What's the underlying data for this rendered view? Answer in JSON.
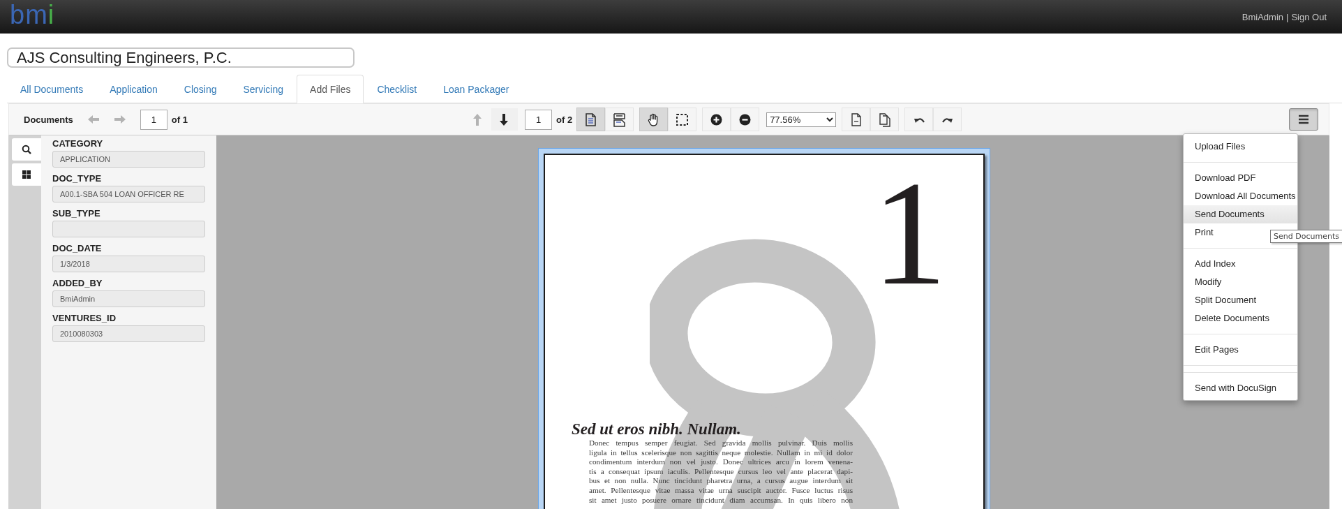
{
  "header": {
    "logo": "bmi",
    "user_link": "BmiAdmin",
    "separator": "|",
    "sign_out_link": "Sign Out"
  },
  "borrower_field": {
    "value": "AJS Consulting Engineers, P.C."
  },
  "tabs": [
    {
      "label": "All Documents",
      "selected": false
    },
    {
      "label": "Application",
      "selected": false
    },
    {
      "label": "Closing",
      "selected": false
    },
    {
      "label": "Servicing",
      "selected": false
    },
    {
      "label": "Add Files",
      "selected": true
    },
    {
      "label": "Checklist",
      "selected": false
    },
    {
      "label": "Loan Packager",
      "selected": false
    }
  ],
  "toolbar": {
    "documents_label": "Documents",
    "document_nav": [
      {
        "kind": "left",
        "disabled": true
      },
      {
        "kind": "right",
        "disabled": true
      }
    ],
    "document_number": "1",
    "document_total": "of 1",
    "page_nav": [
      {
        "kind": "up",
        "disabled": true
      },
      {
        "kind": "down",
        "disabled": false
      }
    ],
    "page_number": "1",
    "page_total": "of 2",
    "groups": [
      {
        "kind": "buttons",
        "buttons": [
          {
            "kind": "single-page",
            "selected": true
          },
          {
            "kind": "two-page",
            "selected": false
          }
        ]
      },
      {
        "kind": "buttons",
        "buttons": [
          {
            "kind": "hand",
            "selected": true
          },
          {
            "kind": "marquee",
            "selected": false
          }
        ]
      },
      {
        "kind": "buttons",
        "buttons": [
          {
            "kind": "zoom-in",
            "selected": false
          },
          {
            "kind": "zoom-out",
            "selected": false
          }
        ]
      },
      {
        "kind": "select",
        "value": "77.56%"
      },
      {
        "kind": "buttons",
        "buttons": [
          {
            "kind": "page",
            "selected": false
          },
          {
            "kind": "pages",
            "selected": false
          }
        ]
      },
      {
        "kind": "buttons",
        "buttons": [
          {
            "kind": "undo",
            "selected": false
          },
          {
            "kind": "redo",
            "selected": false
          }
        ]
      }
    ],
    "menu_button": {
      "expanded": true
    }
  },
  "side_buttons": [
    {
      "kind": "search"
    },
    {
      "kind": "grid"
    }
  ],
  "fields": [
    {
      "label": "CATEGORY",
      "value": "APPLICATION",
      "disabled": true
    },
    {
      "label": "DOC_TYPE",
      "value": "A00.1-SBA 504 LOAN OFFICER RE",
      "disabled": true
    },
    {
      "label": "SUB_TYPE",
      "disabled": true
    },
    {
      "label": "DOC_DATE",
      "value": "1/3/2018",
      "disabled": true
    },
    {
      "label": "ADDED_BY",
      "value": "BmiAdmin",
      "disabled": true
    },
    {
      "label": "VENTURES_ID",
      "value": "2010080303",
      "disabled": true
    }
  ],
  "document": {
    "page_number": "1",
    "heading": "Sed ut eros nibh. Nullam.",
    "body_lines": [
      "Donec tempus semper feugiat. Sed gravida mollis pulvinar. Duis mollis",
      "ligula in tellus scelerisque non sagittis neque molestie. Nullam in mi id dolor",
      "condimentum interdum non vel justo. Donec ultrices arcu in lorem venena-",
      "tis a consequat ipsum iaculis. Pellentesque cursus leo vel ante placerat dapi-",
      "bus et non nulla. Nunc tincidunt pharetra urna, a cursus augue interdum sit",
      "amet. Pellentesque vitae massa vitae urna suscipit auctor. Fusce luctus risus",
      "sit amet justo posuere ornare tincidunt diam accumsan. In quis libero non"
    ]
  },
  "menu": {
    "items": [
      {
        "kind": "item",
        "label": "Upload Files",
        "highlighted": false
      },
      {
        "kind": "divider"
      },
      {
        "kind": "item",
        "label": "Download PDF",
        "highlighted": false
      },
      {
        "kind": "item",
        "label": "Download All Documents",
        "highlighted": false
      },
      {
        "kind": "item",
        "label": "Send Documents",
        "highlighted": true
      },
      {
        "kind": "item",
        "label": "Print",
        "highlighted": false
      },
      {
        "kind": "divider"
      },
      {
        "kind": "item",
        "label": "Add Index",
        "highlighted": false
      },
      {
        "kind": "item",
        "label": "Modify",
        "highlighted": false
      },
      {
        "kind": "item",
        "label": "Split Document",
        "highlighted": false
      },
      {
        "kind": "item",
        "label": "Delete Documents",
        "highlighted": false
      },
      {
        "kind": "divider"
      },
      {
        "kind": "item",
        "label": "Edit Pages",
        "highlighted": false
      },
      {
        "kind": "divider"
      },
      {
        "kind": "divider"
      },
      {
        "kind": "item",
        "label": "Send with DocuSign",
        "highlighted": false
      }
    ]
  },
  "tooltip": {
    "text": "Send Documents"
  }
}
